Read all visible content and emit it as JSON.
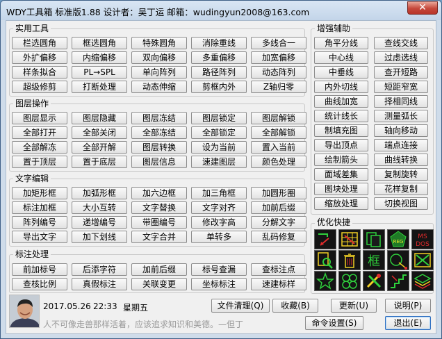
{
  "title": "WDY工具箱 标准版1.88   设计者：吴丁运   邮箱：wudingyun2008@163.com",
  "close_label": "✕",
  "groups": {
    "practical": {
      "label": "实用工具",
      "buttons": [
        "栏选圆角",
        "框选圆角",
        "特殊圆角",
        "消除重线",
        "多线合一",
        "外扩偏移",
        "内缩偏移",
        "双向偏移",
        "多重偏移",
        "加宽偏移",
        "样条拟合",
        "PL→SPL",
        "单向阵列",
        "路径阵列",
        "动态阵列",
        "超级修剪",
        "打断处理",
        "动态伸缩",
        "剪框内外",
        "Z轴归零"
      ]
    },
    "layer": {
      "label": "图层操作",
      "buttons": [
        "图层显示",
        "图层隐藏",
        "图层冻结",
        "图层锁定",
        "图层解锁",
        "全部打开",
        "全部关闭",
        "全部冻结",
        "全部锁定",
        "全部解锁",
        "全部解冻",
        "全部开解",
        "图层转换",
        "设为当前",
        "置入当前",
        "置于顶层",
        "置于底层",
        "图层信息",
        "速建图层",
        "颜色处理"
      ]
    },
    "text": {
      "label": "文字编辑",
      "buttons": [
        "加矩形框",
        "加弧形框",
        "加六边框",
        "加三角框",
        "加圆形圈",
        "标注加框",
        "大小互转",
        "文字替换",
        "文字对齐",
        "加前后缀",
        "阵列编号",
        "递增编号",
        "带圈编号",
        "修改字高",
        "分解文字",
        "导出文字",
        "加下划线",
        "文字合并",
        "单转多",
        "乱码修复"
      ]
    },
    "dim": {
      "label": "标注处理",
      "buttons": [
        "前加标号",
        "后添字符",
        "加前后缀",
        "标号查漏",
        "查标注点",
        "查核比例",
        "真假标注",
        "关联变更",
        "坐标标注",
        "速建标样"
      ]
    },
    "enhance": {
      "label": "增强辅助",
      "buttons": [
        "角平分线",
        "查线交线",
        "中心线",
        "过虑选线",
        "中垂线",
        "查开短路",
        "内外切线",
        "短距窄宽",
        "曲线加宽",
        "择相同线",
        "统计线长",
        "测量弧长",
        "制填充图",
        "轴向移动",
        "导出顶点",
        "端点连接",
        "绘制箭头",
        "曲线转换",
        "面域差集",
        "复制旋转",
        "图块处理",
        "花样复制",
        "缩放处理",
        "切换视图"
      ]
    },
    "quick": {
      "label": "优化快捷",
      "icons": [
        "pline-edit-icon",
        "table-grid-icon",
        "copy-pages-icon",
        "reg-badge-icon",
        "ms-dos-icon",
        "search-doc-icon",
        "trash-bin-icon",
        "frame-char-icon",
        "circle-link-icon",
        "diagonal-arrow-icon",
        "star-icon",
        "hexagon-cluster-icon",
        "tools-icon",
        "stairs-icon",
        "layers-icon"
      ],
      "frame_char": "框",
      "reg_text": "REG",
      "msdos_text": [
        "MS",
        "DOS"
      ]
    }
  },
  "footer": {
    "date": "2017.05.26",
    "time": "22:33",
    "weekday": "星期五",
    "motto": "人不可像走兽那样活着，应该追求知识和美德。—但丁",
    "buttons": {
      "clean": "文件清理(Q)",
      "favorite": "收藏(B)",
      "update": "更新(U)",
      "help": "说明(P)",
      "settings": "命令设置(S)",
      "exit": "退出(E)"
    }
  }
}
